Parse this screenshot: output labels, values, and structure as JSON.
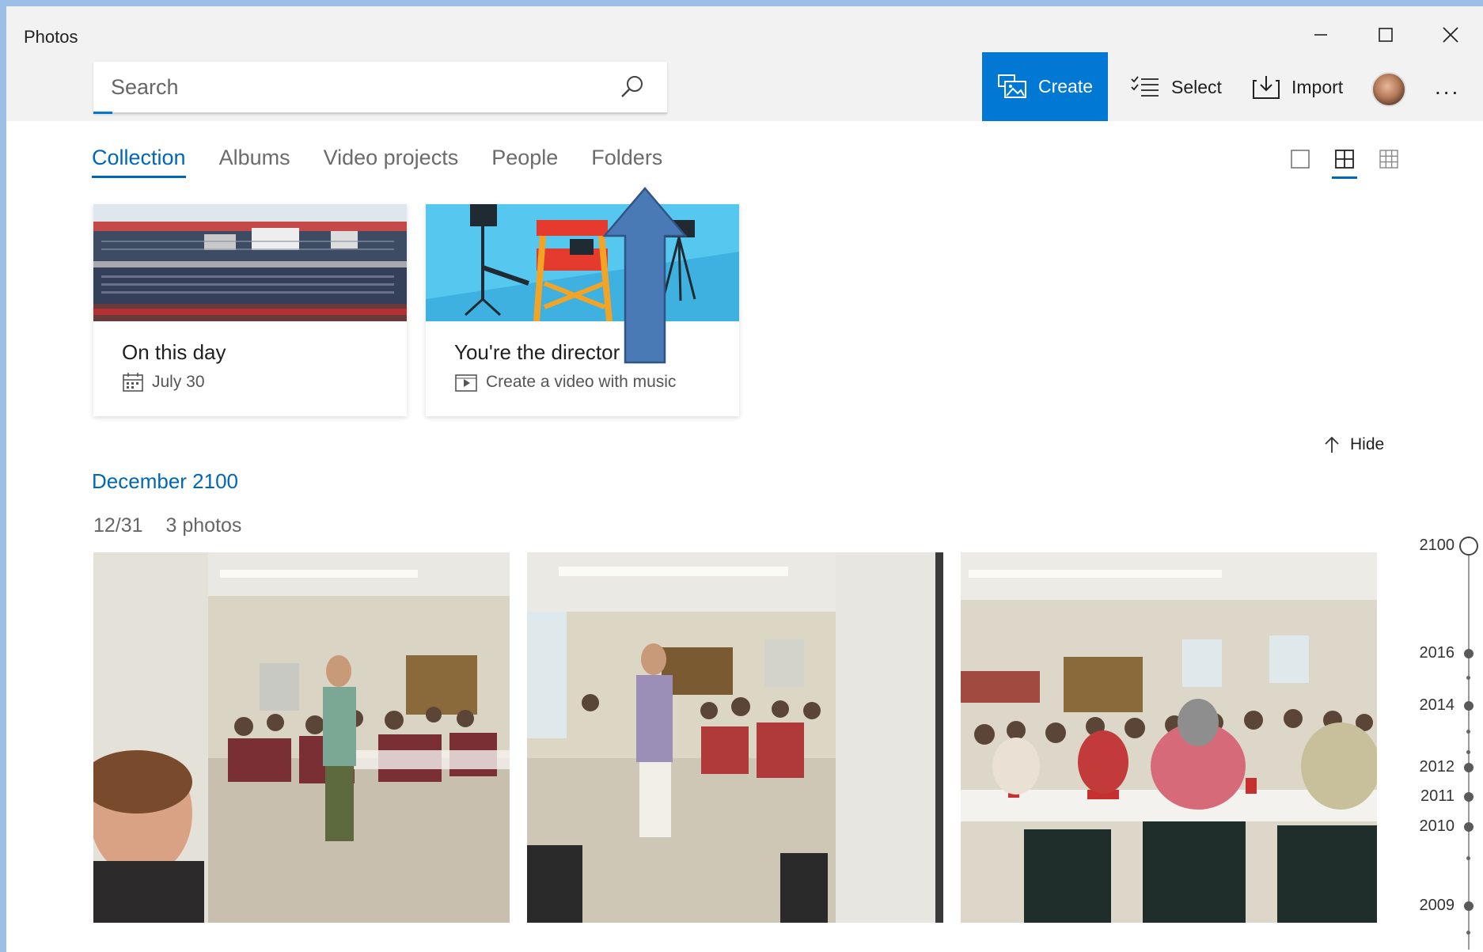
{
  "window": {
    "title": "Photos"
  },
  "search": {
    "placeholder": "Search",
    "value": ""
  },
  "toolbar": {
    "create_label": "Create",
    "select_label": "Select",
    "import_label": "Import",
    "more_label": "..."
  },
  "tabs": [
    {
      "label": "Collection",
      "active": true
    },
    {
      "label": "Albums",
      "active": false
    },
    {
      "label": "Video projects",
      "active": false
    },
    {
      "label": "People",
      "active": false
    },
    {
      "label": "Folders",
      "active": false
    }
  ],
  "view_modes": [
    "single",
    "medium-grid",
    "small-grid"
  ],
  "cards": [
    {
      "title": "On this day",
      "subtitle": "July 30",
      "icon": "calendar-icon"
    },
    {
      "title": "You're the director",
      "subtitle": "Create a video with music",
      "icon": "video-icon"
    }
  ],
  "hide_label": "Hide",
  "section": {
    "month": "December 2100",
    "date": "12/31",
    "count": "3 photos"
  },
  "timeline": {
    "years": [
      "2100",
      "2016",
      "2014",
      "2012",
      "2011",
      "2010",
      "2009"
    ]
  },
  "colors": {
    "accent": "#0078d4",
    "tab_active": "#0067b8",
    "arrow": "#4a7ab5"
  }
}
